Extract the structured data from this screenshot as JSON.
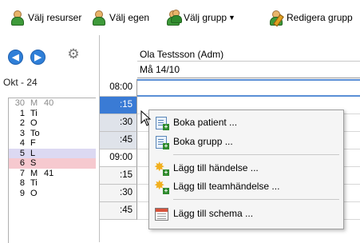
{
  "toolbar": {
    "items": [
      {
        "label": "Välj resurser",
        "icon": "person-icon"
      },
      {
        "label": "Välj egen",
        "icon": "person-icon"
      },
      {
        "label": "Välj grupp",
        "icon": "group-icon"
      },
      {
        "label": "Redigera grupp",
        "icon": "edit-group-icon"
      }
    ]
  },
  "nav": {
    "prev": "◀",
    "next": "▶",
    "settings_icon": "gear-icon"
  },
  "calendar": {
    "month_label": "Okt - 24",
    "days": [
      {
        "d": "30",
        "w": "M",
        "wk": "40",
        "kind": "grey"
      },
      {
        "d": "1",
        "w": "Ti",
        "wk": "",
        "kind": ""
      },
      {
        "d": "2",
        "w": "O",
        "wk": "",
        "kind": ""
      },
      {
        "d": "3",
        "w": "To",
        "wk": "",
        "kind": ""
      },
      {
        "d": "4",
        "w": "F",
        "wk": "",
        "kind": ""
      },
      {
        "d": "5",
        "w": "L",
        "wk": "",
        "kind": "sat"
      },
      {
        "d": "6",
        "w": "S",
        "wk": "",
        "kind": "sun"
      },
      {
        "d": "7",
        "w": "M",
        "wk": "41",
        "kind": ""
      },
      {
        "d": "8",
        "w": "Ti",
        "wk": "",
        "kind": ""
      },
      {
        "d": "9",
        "w": "O",
        "wk": "",
        "kind": ""
      }
    ]
  },
  "schedule": {
    "resource_name": "Ola Testsson (Adm)",
    "date_label": "Må 14/10",
    "times": [
      {
        "label": "08:00",
        "kind": "hour"
      },
      {
        "label": ":15",
        "kind": "sel"
      },
      {
        "label": ":30",
        "kind": "grey"
      },
      {
        "label": ":45",
        "kind": "grey"
      },
      {
        "label": "09:00",
        "kind": "hour"
      },
      {
        "label": ":15",
        "kind": ""
      },
      {
        "label": ":30",
        "kind": ""
      },
      {
        "label": ":45",
        "kind": ""
      }
    ]
  },
  "context_menu": {
    "items": [
      {
        "label": "Boka patient ...",
        "icon": "book-patient-icon"
      },
      {
        "label": "Boka grupp ...",
        "icon": "book-group-icon"
      },
      {
        "label": "Lägg till händelse ...",
        "icon": "add-event-icon"
      },
      {
        "label": "Lägg till teamhändelse ...",
        "icon": "add-team-event-icon"
      },
      {
        "label": "Lägg till schema ...",
        "icon": "add-schedule-icon"
      }
    ]
  }
}
